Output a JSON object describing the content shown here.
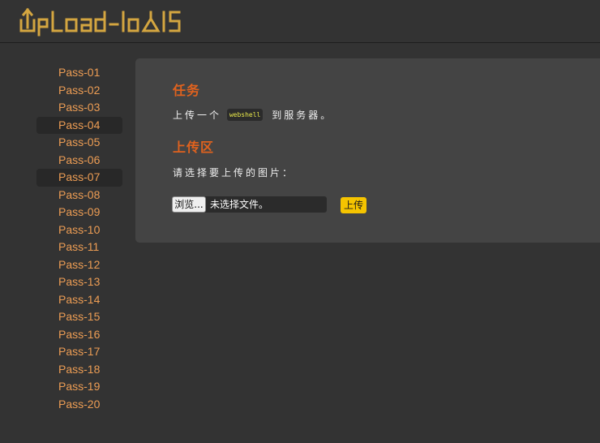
{
  "app": {
    "logo_text": "UpLoad-labS"
  },
  "colors": {
    "background": "#333333",
    "panel": "#444444",
    "accent_orange": "#e0621e",
    "nav_link": "#ed9d54",
    "logo_gold": "#d4a640",
    "upload_button": "#f5c400"
  },
  "sidebar": {
    "items": [
      {
        "label": "Pass-01",
        "active": false
      },
      {
        "label": "Pass-02",
        "active": false
      },
      {
        "label": "Pass-03",
        "active": false
      },
      {
        "label": "Pass-04",
        "active": true
      },
      {
        "label": "Pass-05",
        "active": false
      },
      {
        "label": "Pass-06",
        "active": false
      },
      {
        "label": "Pass-07",
        "active": true
      },
      {
        "label": "Pass-08",
        "active": false
      },
      {
        "label": "Pass-09",
        "active": false
      },
      {
        "label": "Pass-10",
        "active": false
      },
      {
        "label": "Pass-11",
        "active": false
      },
      {
        "label": "Pass-12",
        "active": false
      },
      {
        "label": "Pass-13",
        "active": false
      },
      {
        "label": "Pass-14",
        "active": false
      },
      {
        "label": "Pass-15",
        "active": false
      },
      {
        "label": "Pass-16",
        "active": false
      },
      {
        "label": "Pass-17",
        "active": false
      },
      {
        "label": "Pass-18",
        "active": false
      },
      {
        "label": "Pass-19",
        "active": false
      },
      {
        "label": "Pass-20",
        "active": false
      }
    ]
  },
  "main": {
    "task_title": "任务",
    "task_desc_before": "上传一个",
    "task_code": "webshell",
    "task_desc_after": "到服务器。",
    "upload_title": "上传区",
    "upload_prompt": "请选择要上传的图片：",
    "browse_label": "浏览...",
    "file_status": "未选择文件。",
    "upload_button": "上传"
  }
}
